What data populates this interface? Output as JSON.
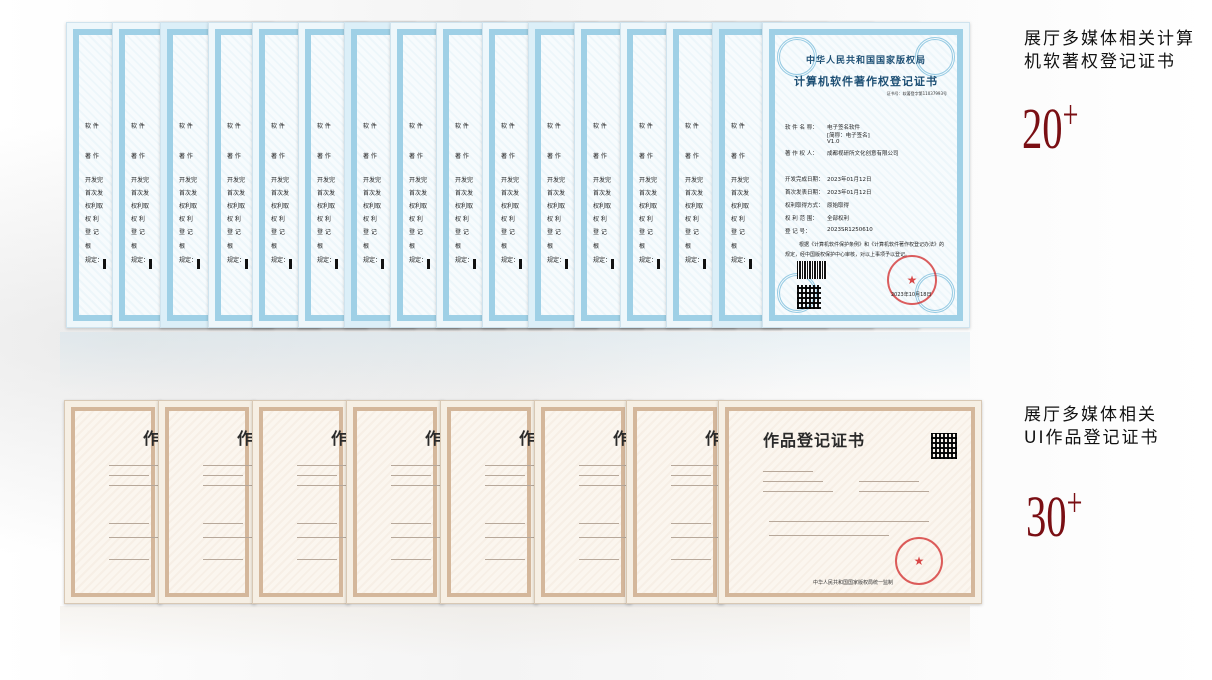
{
  "software": {
    "heading": "展厅多媒体相关计算机软著权登记证书",
    "heading_lines": [
      "展厅多媒体相关计算",
      "机软著权登记证书"
    ],
    "count": "20",
    "count_suffix": "+",
    "certificate": {
      "authority": "中华人民共和国国家版权局",
      "title": "计算机软件著作权登记证书",
      "serial": "证书号：软著登字第11037993号",
      "rows": [
        {
          "label": "软 件 名 称：",
          "value": "电子签名软件"
        },
        {
          "label": "",
          "value": "[简称：电子签名]"
        },
        {
          "label": "",
          "value": "V1.0"
        },
        {
          "label": "著 作 权 人：",
          "value": "成都视研所文化创意有限公司"
        },
        {
          "label": "开发完成日期：",
          "value": "2023年01月12日"
        },
        {
          "label": "首次发表日期：",
          "value": "2023年01月12日"
        },
        {
          "label": "权利取得方式：",
          "value": "原始取得"
        },
        {
          "label": "权 利 范 围：",
          "value": "全部权利"
        },
        {
          "label": "登 记 号：",
          "value": "2023SR1250610"
        }
      ],
      "basis_lines": [
        "根据《计算机软件保护条例》和《计算机软件著作权登记办法》的",
        "规定，经中国版权保护中心审核，对以上事项予以登记。"
      ],
      "date": "2023年10月18日"
    },
    "stack_fields": [
      "软 件",
      "著 作",
      "开发完",
      "首次发",
      "权利取",
      "权 利",
      "登 记",
      "根",
      "规定："
    ]
  },
  "ui_works": {
    "heading_lines": [
      "展厅多媒体相关",
      "UI作品登记证书"
    ],
    "count": "30",
    "count_suffix": "+",
    "certificate": {
      "title": "作品登记证书",
      "stack_title": "作",
      "footer": "中华人民共和国国家版权局统一监制"
    }
  },
  "colors": {
    "accent_red": "#7a0f14",
    "seal_red": "#d22828",
    "software_border": "#9fd0e6",
    "works_border": "#d4b79b"
  }
}
